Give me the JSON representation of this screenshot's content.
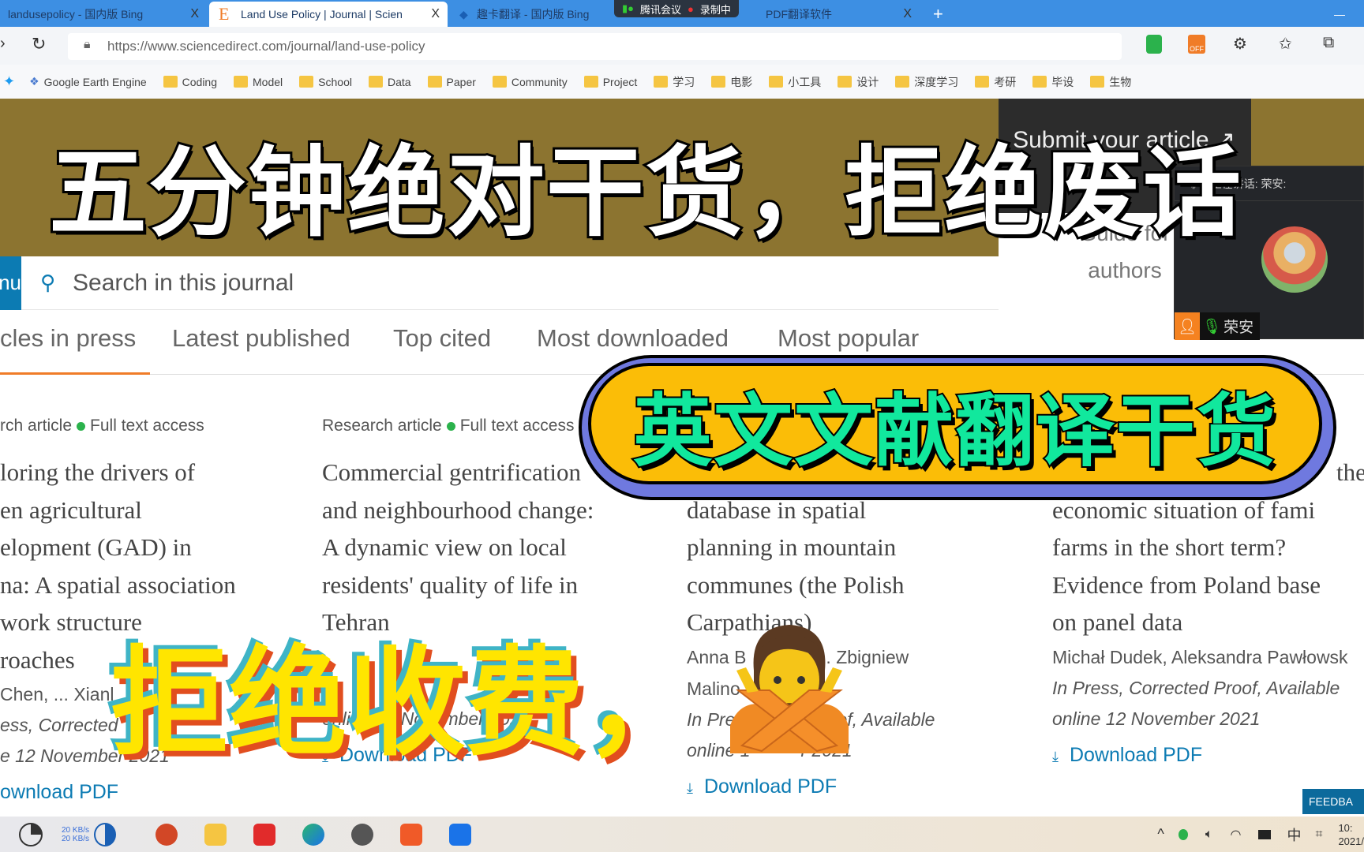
{
  "browser": {
    "tabs": [
      {
        "title": "landusepolicy - 国内版 Bing",
        "close": "X"
      },
      {
        "title": "Land Use Policy | Journal | Scien",
        "close": "X",
        "active": true
      },
      {
        "title": "趣卡翻译 - 国内版 Bing"
      },
      {
        "title": "PDF翻译软件",
        "close": "X"
      }
    ],
    "new_tab": "+",
    "meeting_status": {
      "app": "腾讯会议",
      "recording": "录制中"
    },
    "url": "https://www.sciencedirect.com/journal/land-use-policy",
    "bookmarks": [
      "Google Earth Engine",
      "Coding",
      "Model",
      "School",
      "Data",
      "Paper",
      "Community",
      "Project",
      "学习",
      "电影",
      "小工具",
      "设计",
      "深度学习",
      "考研",
      "毕设",
      "生物"
    ]
  },
  "journal": {
    "submit_label": "Submit your article",
    "submit_icon": "arrow-up-right",
    "guide_label": [
      "Guide for",
      "authors"
    ],
    "menu_label": "Menu",
    "search_placeholder": "Search in this journal",
    "tabs": [
      "cles in press",
      "Latest published",
      "Top cited",
      "Most downloaded",
      "Most popular"
    ],
    "active_tab": 0,
    "accent": "#f07c28",
    "articles": [
      {
        "type": "rch article",
        "access": "Full text access",
        "title_lines": [
          "loring the drivers of",
          "en agricultural",
          "elopment (GAD) in",
          "na: A spatial association",
          "work structure",
          "roaches"
        ],
        "authors": [
          "Chen, ... Xianl"
        ],
        "dates": [
          "ess, Corrected",
          "e 12 November 2021"
        ],
        "download": "ownload PDF"
      },
      {
        "type": "Research article",
        "access": "Full text access",
        "title_lines": [
          "Commercial gentrification",
          "and neighbourhood change:",
          "A dynamic view on local",
          "residents' quality of life in",
          "Tehran"
        ],
        "authors": [
          ""
        ],
        "dates": [
          "",
          "online 12 November 2021"
        ],
        "download": "Download PDF"
      },
      {
        "type": "",
        "access": "",
        "title_lines": [
          "",
          "database in spatial",
          "planning in mountain",
          "communes (the Polish",
          "Carpathians)"
        ],
        "authors": [
          "Anna B          ia,... Zbigniew",
          "Malino"
        ],
        "dates": [
          "In Press,          Proof, Available",
          "online 1          r 2021"
        ],
        "download": "Download PDF"
      },
      {
        "type": "",
        "access": "",
        "title_lines": [
          "the",
          "economic situation of fami",
          "farms in the short term?",
          "Evidence from Poland base",
          "on panel data"
        ],
        "authors": [
          "Michał Dudek, Aleksandra Pawłowsk"
        ],
        "dates": [
          "In Press, Corrected Proof, Available",
          "online 12 November 2021"
        ],
        "download": "Download PDF"
      }
    ],
    "feedback": "FEEDBA"
  },
  "meeting": {
    "speaking": "正在讲话: 荣安:",
    "name": "荣安"
  },
  "taskbar": {
    "net_up": "20 KB/s",
    "net_down": "20 KB/s",
    "ime": "中",
    "time": "10:",
    "date": "2021/"
  },
  "overlay": {
    "headline": "五分钟绝对干货，拒绝废话",
    "pill": "英文文献翻译干货",
    "no_fee": "拒绝收费，",
    "emoji": "person-gesturing-no",
    "colors": {
      "pill_bg": "#fbbd07",
      "pill_border": "#6f79df",
      "pill_text": "#11e89d",
      "no_fee": "#ffe500",
      "banner": "#8c7430"
    }
  }
}
